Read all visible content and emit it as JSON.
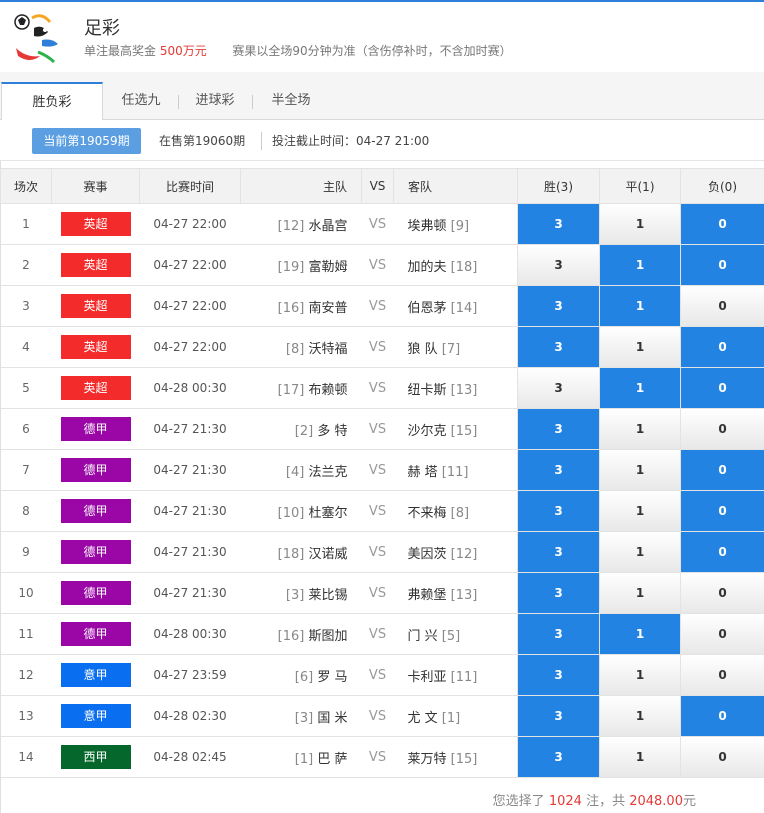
{
  "header": {
    "title": "足彩",
    "subtitle_prefix": "单注最高奖金",
    "subtitle_amount": "500万元",
    "subtitle_note": "赛果以全场90分钟为准（含伤停补时，不含加时赛）"
  },
  "tabs": [
    {
      "label": "胜负彩",
      "active": true
    },
    {
      "label": "任选九",
      "active": false
    },
    {
      "label": "进球彩",
      "active": false
    },
    {
      "label": "半全场",
      "active": false
    }
  ],
  "issues": {
    "current": "当前第19059期",
    "next": "在售第19060期",
    "deadline": "投注截止时间：04-27 21:00"
  },
  "table": {
    "headers": [
      "场次",
      "赛事",
      "比赛时间",
      "主队",
      "VS",
      "客队",
      "胜(3)",
      "平(1)",
      "负(0)"
    ],
    "odds_labels": [
      "3",
      "1",
      "0"
    ],
    "rows": [
      {
        "no": "1",
        "league": "英超",
        "league_color": "#f42b2b",
        "time": "04-27 22:00",
        "home_rank": "[12]",
        "home": "水晶宫",
        "away": "埃弗顿",
        "away_rank": "[9]",
        "sel": [
          true,
          false,
          true
        ]
      },
      {
        "no": "2",
        "league": "英超",
        "league_color": "#f42b2b",
        "time": "04-27 22:00",
        "home_rank": "[19]",
        "home": "富勒姆",
        "away": "加的夫",
        "away_rank": "[18]",
        "sel": [
          false,
          true,
          true
        ]
      },
      {
        "no": "3",
        "league": "英超",
        "league_color": "#f42b2b",
        "time": "04-27 22:00",
        "home_rank": "[16]",
        "home": "南安普",
        "away": "伯恩茅",
        "away_rank": "[14]",
        "sel": [
          true,
          true,
          false
        ]
      },
      {
        "no": "4",
        "league": "英超",
        "league_color": "#f42b2b",
        "time": "04-27 22:00",
        "home_rank": "[8]",
        "home": "沃特福",
        "away": "狼 队",
        "away_rank": "[7]",
        "sel": [
          true,
          false,
          true
        ]
      },
      {
        "no": "5",
        "league": "英超",
        "league_color": "#f42b2b",
        "time": "04-28 00:30",
        "home_rank": "[17]",
        "home": "布赖顿",
        "away": "纽卡斯",
        "away_rank": "[13]",
        "sel": [
          false,
          true,
          true
        ]
      },
      {
        "no": "6",
        "league": "德甲",
        "league_color": "#9a07a6",
        "time": "04-27 21:30",
        "home_rank": "[2]",
        "home": "多 特",
        "away": "沙尔克",
        "away_rank": "[15]",
        "sel": [
          true,
          false,
          false
        ]
      },
      {
        "no": "7",
        "league": "德甲",
        "league_color": "#9a07a6",
        "time": "04-27 21:30",
        "home_rank": "[4]",
        "home": "法兰克",
        "away": "赫 塔",
        "away_rank": "[11]",
        "sel": [
          true,
          false,
          true
        ]
      },
      {
        "no": "8",
        "league": "德甲",
        "league_color": "#9a07a6",
        "time": "04-27 21:30",
        "home_rank": "[10]",
        "home": "杜塞尔",
        "away": "不来梅",
        "away_rank": "[8]",
        "sel": [
          true,
          false,
          true
        ]
      },
      {
        "no": "9",
        "league": "德甲",
        "league_color": "#9a07a6",
        "time": "04-27 21:30",
        "home_rank": "[18]",
        "home": "汉诺威",
        "away": "美因茨",
        "away_rank": "[12]",
        "sel": [
          true,
          false,
          true
        ]
      },
      {
        "no": "10",
        "league": "德甲",
        "league_color": "#9a07a6",
        "time": "04-27 21:30",
        "home_rank": "[3]",
        "home": "莱比锡",
        "away": "弗赖堡",
        "away_rank": "[13]",
        "sel": [
          true,
          false,
          false
        ]
      },
      {
        "no": "11",
        "league": "德甲",
        "league_color": "#9a07a6",
        "time": "04-28 00:30",
        "home_rank": "[16]",
        "home": "斯图加",
        "away": "门 兴",
        "away_rank": "[5]",
        "sel": [
          true,
          true,
          false
        ]
      },
      {
        "no": "12",
        "league": "意甲",
        "league_color": "#0a6ef0",
        "time": "04-27 23:59",
        "home_rank": "[6]",
        "home": "罗 马",
        "away": "卡利亚",
        "away_rank": "[11]",
        "sel": [
          true,
          false,
          false
        ]
      },
      {
        "no": "13",
        "league": "意甲",
        "league_color": "#0a6ef0",
        "time": "04-28 02:30",
        "home_rank": "[3]",
        "home": "国 米",
        "away": "尤 文",
        "away_rank": "[1]",
        "sel": [
          true,
          false,
          true
        ]
      },
      {
        "no": "14",
        "league": "西甲",
        "league_color": "#06672d",
        "time": "04-28 02:45",
        "home_rank": "[1]",
        "home": "巴 萨",
        "away": "莱万特",
        "away_rank": "[15]",
        "sel": [
          true,
          false,
          false
        ]
      }
    ]
  },
  "footer": {
    "prefix": "您选择了",
    "count": "1024",
    "mid": "注，共",
    "amount": "2048.00",
    "suffix": "元"
  }
}
